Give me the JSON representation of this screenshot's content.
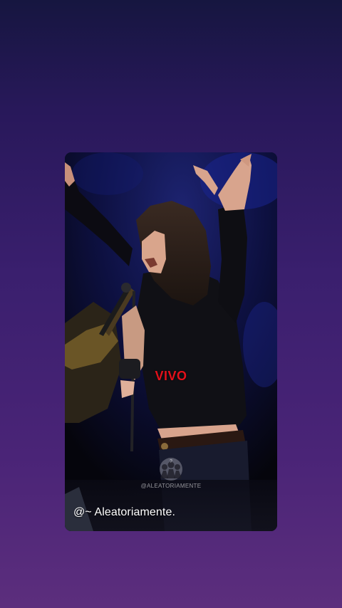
{
  "post": {
    "overlay_text": "VIVO",
    "caption": "@~ Aleatoriamente.",
    "watermark_handle": "@ALEATORIAMENTE",
    "overlay_color": "#e3101a"
  },
  "background": {
    "top_color": "#161640",
    "bottom_color": "#5c2e7d"
  },
  "icons": {
    "watermark": "masked-figures-logo-icon"
  }
}
